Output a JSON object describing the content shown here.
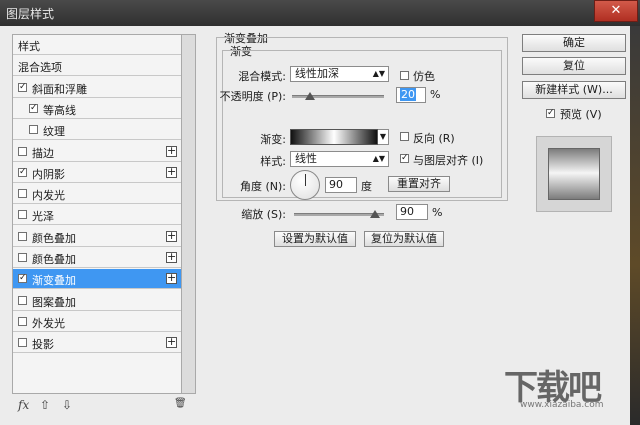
{
  "window": {
    "title": "图层样式",
    "close": "✕"
  },
  "sidebar": {
    "items": [
      {
        "label": "样式",
        "checkbox": false,
        "checked": false,
        "plus": false
      },
      {
        "label": "混合选项",
        "checkbox": false,
        "checked": false,
        "plus": false
      },
      {
        "label": "斜面和浮雕",
        "checkbox": true,
        "checked": true,
        "plus": false
      },
      {
        "label": "等高线",
        "checkbox": true,
        "checked": true,
        "plus": false,
        "indent": true
      },
      {
        "label": "纹理",
        "checkbox": true,
        "checked": false,
        "plus": false,
        "indent": true
      },
      {
        "label": "描边",
        "checkbox": true,
        "checked": false,
        "plus": true
      },
      {
        "label": "内阴影",
        "checkbox": true,
        "checked": true,
        "plus": true
      },
      {
        "label": "内发光",
        "checkbox": true,
        "checked": false,
        "plus": false
      },
      {
        "label": "光泽",
        "checkbox": true,
        "checked": false,
        "plus": false
      },
      {
        "label": "颜色叠加",
        "checkbox": true,
        "checked": false,
        "plus": true
      },
      {
        "label": "颜色叠加",
        "checkbox": true,
        "checked": false,
        "plus": true
      },
      {
        "label": "渐变叠加",
        "checkbox": true,
        "checked": true,
        "plus": true,
        "selected": true
      },
      {
        "label": "图案叠加",
        "checkbox": true,
        "checked": false,
        "plus": false
      },
      {
        "label": "外发光",
        "checkbox": true,
        "checked": false,
        "plus": false
      },
      {
        "label": "投影",
        "checkbox": true,
        "checked": false,
        "plus": true
      }
    ],
    "bottom": {
      "fx": "fx",
      "up": "⇧",
      "down": "⇩",
      "trash": "🗑"
    }
  },
  "panel": {
    "section_title": "渐变叠加",
    "group_title": "渐变",
    "blend_mode_label": "混合模式:",
    "blend_mode_value": "线性加深",
    "dither_label": "仿色",
    "opacity_label": "不透明度 (P):",
    "opacity_value": "20",
    "opacity_pct": 20,
    "pct": "%",
    "gradient_label": "渐变:",
    "reverse_label": "反向 (R)",
    "style_label": "样式:",
    "style_value": "线性",
    "align_label": "与图层对齐 (I)",
    "angle_label": "角度 (N):",
    "angle_value": "90",
    "angle_unit": "度",
    "reset_align": "重置对齐",
    "scale_label": "缩放 (S):",
    "scale_value": "90",
    "scale_pct": 90,
    "make_default": "设置为默认值",
    "reset_default": "复位为默认值"
  },
  "right": {
    "ok": "确定",
    "reset": "复位",
    "new_style": "新建样式 (W)...",
    "preview_label": "预览 (V)"
  },
  "watermark": {
    "text": "下载吧",
    "url": "www.xiazaiba.com"
  }
}
